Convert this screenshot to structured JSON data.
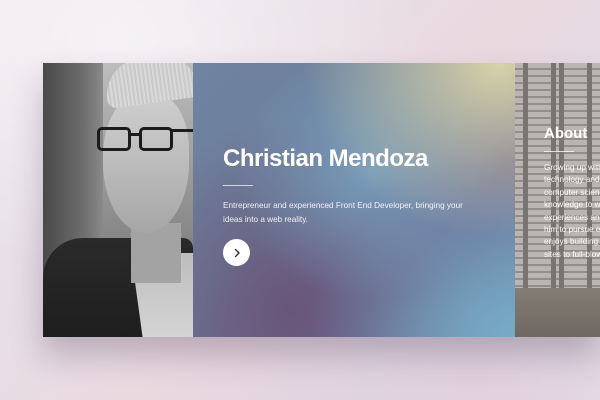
{
  "hero": {
    "name": "Christian Mendoza",
    "tagline": "Entrepreneur and experienced Front End Developer, bringing your ideas into a web reality.",
    "next_icon": "chevron-right-icon"
  },
  "about": {
    "heading": "About",
    "bio_lines": [
      "Growing up with",
      "technology and",
      "computer scienc",
      "knowledge to w",
      "experiences and",
      "him to pursue e",
      "enjoys building",
      "sites to full-blow"
    ]
  },
  "colors": {
    "hero_gradient": [
      "#6f84a2",
      "#6a6690",
      "#ded8aa",
      "#78afc8"
    ],
    "text": "#ffffff",
    "button": "#ffffff"
  }
}
